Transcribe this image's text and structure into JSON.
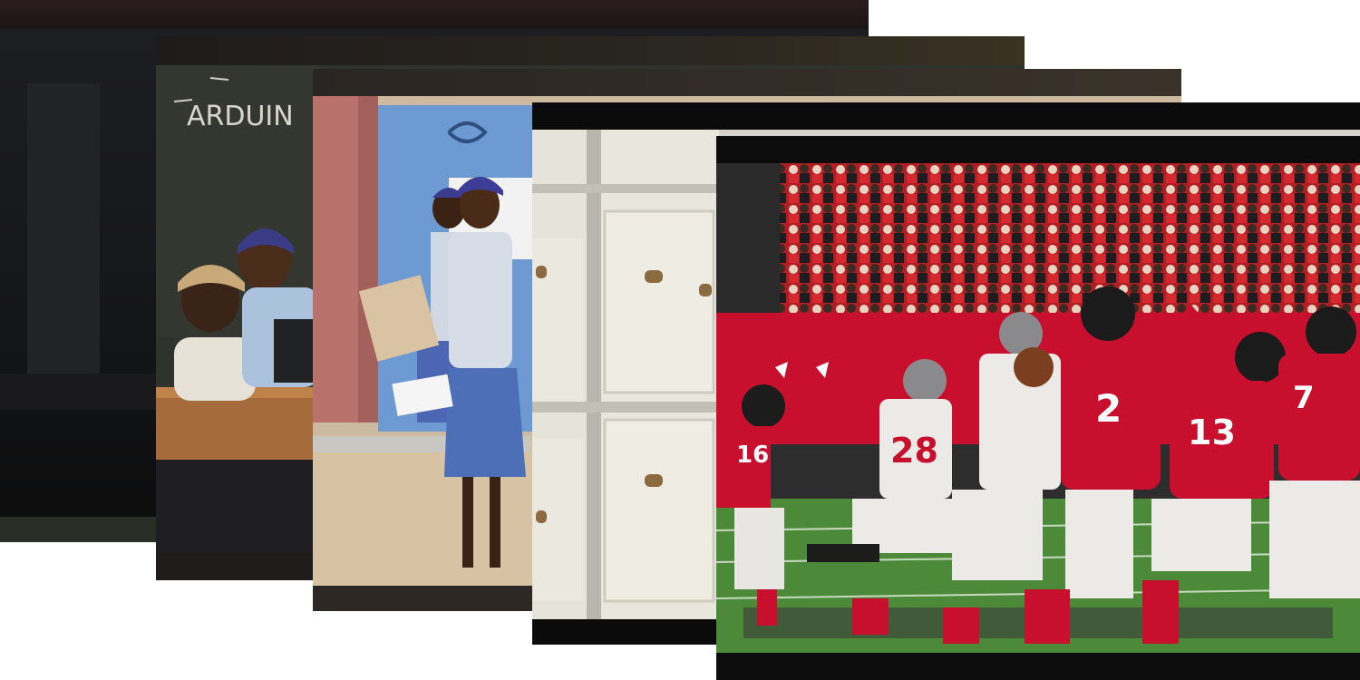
{
  "gallery": {
    "cards": [
      {
        "id": 1,
        "scene": "dark-room"
      },
      {
        "id": 2,
        "scene": "classroom",
        "chalk_text": "ARDUIN"
      },
      {
        "id": 3,
        "scene": "school-girls-walking"
      },
      {
        "id": 4,
        "scene": "archive-storage-boxes"
      },
      {
        "id": 5,
        "scene": "football-game",
        "jersey_numbers": [
          "2",
          "28",
          "13",
          "16",
          "7"
        ]
      }
    ]
  },
  "colors": {
    "falcons_red": "#c8102e",
    "buccaneers_white": "#ebeae6",
    "field_green": "#4c8a3a",
    "uniform_blue": "#4d6fb8"
  }
}
